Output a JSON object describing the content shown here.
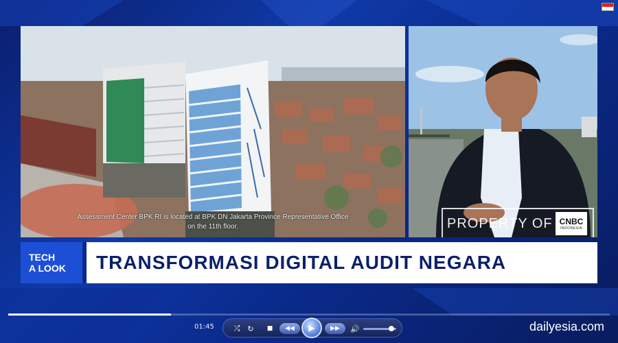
{
  "broadcast": {
    "caption_line1": "Assessment Center BPK RI is located at BPK DN Jakarta Province Representative Office",
    "caption_line2": "on the 11th floor.",
    "watermark": "PROPERTY OF",
    "logo_main": "CNBC",
    "logo_sub": "INDONESIA",
    "segment_tag": [
      "TECH",
      "A LOOK"
    ],
    "headline": "TRANSFORMASI DIGITAL AUDIT NEGARA"
  },
  "player": {
    "current_time": "01:45",
    "progress_fraction": 0.27,
    "volume_fraction": 0.85,
    "buttons": {
      "shuffle": "⤮",
      "repeat": "↻",
      "stop": "■",
      "rewind": "◀◀",
      "play": "▶",
      "forward": "▶▶",
      "volume": "🔊"
    }
  },
  "site_credit": "dailyesia.com",
  "colors": {
    "background": "#0a2a8c",
    "tag_blue": "#1d4fd6",
    "headline_text": "#0c1f6b"
  }
}
